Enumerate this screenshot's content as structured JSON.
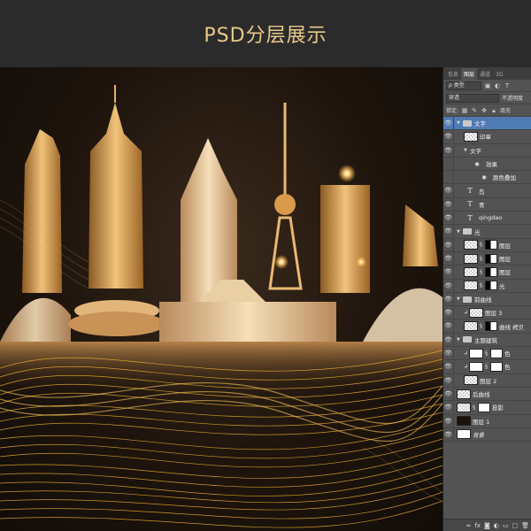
{
  "banner": {
    "title": "PSD分层展示"
  },
  "panel": {
    "tabs": [
      "信息",
      "图层",
      "通道",
      "3D"
    ],
    "active_tab": 1,
    "filter_kind": "ρ 类型",
    "blend_mode": "穿透",
    "opacity_label": "不透明度",
    "lock_label": "锁定:",
    "fill_label": "填充"
  },
  "layers": [
    {
      "name": "文字",
      "type": "group",
      "depth": 0,
      "open": true,
      "selected": true
    },
    {
      "name": "印章",
      "type": "pixel",
      "depth": 1
    },
    {
      "name": "文字",
      "type": "group-sub",
      "depth": 1,
      "open": true
    },
    {
      "name": "效果",
      "type": "effect",
      "depth": 2
    },
    {
      "name": "颜色叠加",
      "type": "effect",
      "depth": 3
    },
    {
      "name": "岛",
      "type": "text",
      "depth": 1
    },
    {
      "name": "青",
      "type": "text",
      "depth": 1
    },
    {
      "name": "qingdao",
      "type": "text",
      "depth": 1
    },
    {
      "name": "光",
      "type": "group",
      "depth": 0,
      "open": true
    },
    {
      "name": "图层",
      "type": "masked",
      "depth": 1
    },
    {
      "name": "图层",
      "type": "masked",
      "depth": 1
    },
    {
      "name": "图层",
      "type": "masked",
      "depth": 1
    },
    {
      "name": "光",
      "type": "masked",
      "depth": 1
    },
    {
      "name": "前曲线",
      "type": "group",
      "depth": 0,
      "open": true
    },
    {
      "name": "图层 3",
      "type": "clipped",
      "depth": 1
    },
    {
      "name": "曲线 拷贝",
      "type": "masked",
      "depth": 1
    },
    {
      "name": "主题建筑",
      "type": "group",
      "depth": 0,
      "open": true
    },
    {
      "name": "色",
      "type": "adjust",
      "depth": 1
    },
    {
      "name": "色",
      "type": "adjust",
      "depth": 1
    },
    {
      "name": "图层 2",
      "type": "pixel",
      "depth": 1
    },
    {
      "name": "后曲线",
      "type": "pixel",
      "depth": 0
    },
    {
      "name": "投影",
      "type": "masked-white",
      "depth": 0
    },
    {
      "name": "图层 1",
      "type": "dark",
      "depth": 0
    },
    {
      "name": "背景",
      "type": "white",
      "depth": 0
    }
  ],
  "bottom_icons": [
    "link-icon",
    "fx-icon",
    "mask-icon",
    "adjustment-icon",
    "folder-icon",
    "new-layer-icon",
    "trash-icon"
  ],
  "colors": {
    "accent": "#e9c98a",
    "panel_bg": "#535353",
    "selected": "#4f7bb4",
    "gold": "#e8b35a"
  }
}
